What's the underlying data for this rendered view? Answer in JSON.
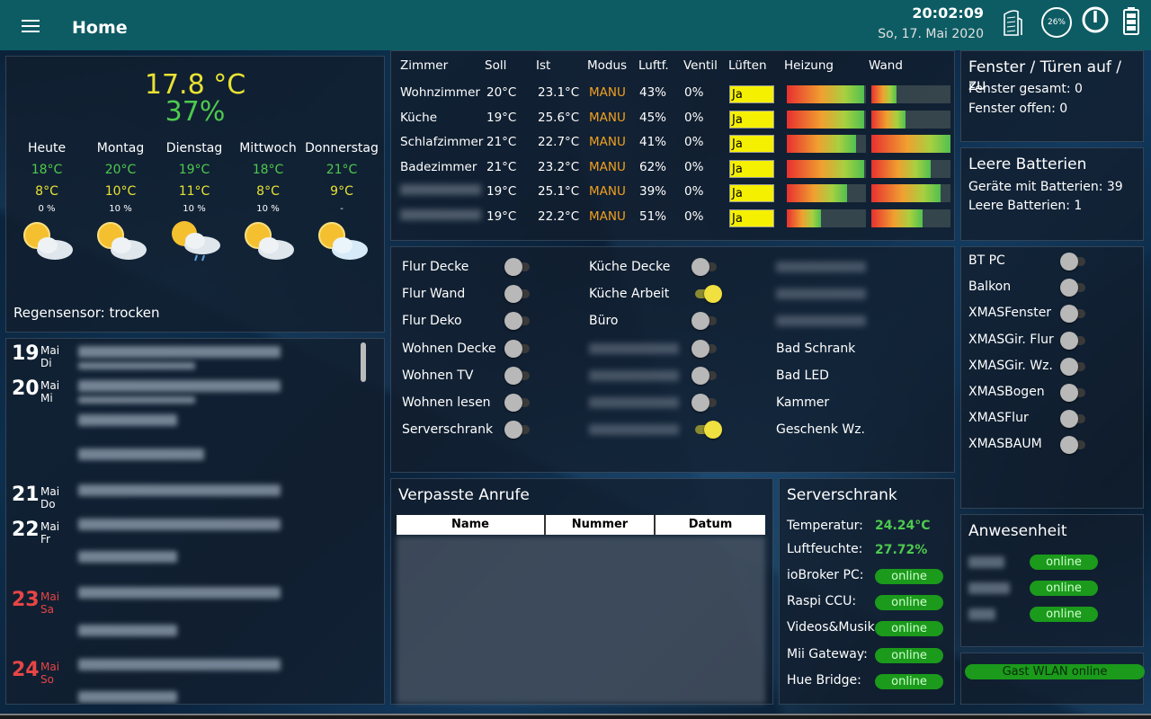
{
  "header": {
    "title": "Home",
    "time": "20:02:09",
    "date": "So, 17. Mai 2020",
    "battery_percent": "26%"
  },
  "weather": {
    "temperature": "17.8 °C",
    "humidity": "37%",
    "forecast": [
      {
        "day": "Heute",
        "high": "18°C",
        "low": "8°C",
        "rain": "0 %",
        "icon": "partly-cloudy-sun-icon"
      },
      {
        "day": "Montag",
        "high": "20°C",
        "low": "10°C",
        "rain": "10 %",
        "icon": "partly-cloudy-sun-icon"
      },
      {
        "day": "Dienstag",
        "high": "19°C",
        "low": "11°C",
        "rain": "10 %",
        "icon": "sun-rain-icon"
      },
      {
        "day": "Mittwoch",
        "high": "18°C",
        "low": "8°C",
        "rain": "10 %",
        "icon": "partly-cloudy-sun-icon"
      },
      {
        "day": "Donnerstag",
        "high": "21°C",
        "low": "9°C",
        "rain": "-",
        "icon": "partly-cloudy-sun-icon"
      }
    ],
    "rain_sensor": "Regensensor: trocken"
  },
  "calendar": {
    "days": [
      {
        "num": "19",
        "month": "Mai",
        "weekday": "Di"
      },
      {
        "num": "20",
        "month": "Mai",
        "weekday": "Mi"
      },
      {
        "num": "21",
        "month": "Mai",
        "weekday": "Do"
      },
      {
        "num": "22",
        "month": "Mai",
        "weekday": "Fr"
      },
      {
        "num": "23",
        "month": "Mai",
        "weekday": "Sa"
      },
      {
        "num": "24",
        "month": "Mai",
        "weekday": "So"
      }
    ]
  },
  "heating": {
    "headers": [
      "Zimmer",
      "Soll",
      "Ist",
      "Modus",
      "Luftf.",
      "Ventil",
      "Lüften",
      "Heizung",
      "Wand"
    ],
    "rows": [
      {
        "room": "Wohnzimmer",
        "soll": "20°C",
        "ist": "23.1°C",
        "mode": "MANU",
        "humidity": "43%",
        "valve": "0%",
        "vent": "Ja",
        "heat_level": 0.98,
        "wall_level": 0.32
      },
      {
        "room": "Küche",
        "soll": "19°C",
        "ist": "25.6°C",
        "mode": "MANU",
        "humidity": "45%",
        "valve": "0%",
        "vent": "Ja",
        "heat_level": 0.98,
        "wall_level": 0.43
      },
      {
        "room": "Schlafzimmer",
        "soll": "21°C",
        "ist": "22.7°C",
        "mode": "MANU",
        "humidity": "41%",
        "valve": "0%",
        "vent": "Ja",
        "heat_level": 0.88,
        "wall_level": 1.0
      },
      {
        "room": "Badezimmer",
        "soll": "21°C",
        "ist": "23.2°C",
        "mode": "MANU",
        "humidity": "62%",
        "valve": "0%",
        "vent": "Ja",
        "heat_level": 0.98,
        "wall_level": 0.75
      },
      {
        "room": "",
        "soll": "19°C",
        "ist": "25.1°C",
        "mode": "MANU",
        "humidity": "39%",
        "valve": "0%",
        "vent": "Ja",
        "heat_level": 0.76,
        "wall_level": 0.87
      },
      {
        "room": "",
        "soll": "19°C",
        "ist": "22.2°C",
        "mode": "MANU",
        "humidity": "51%",
        "valve": "0%",
        "vent": "Ja",
        "heat_level": 0.43,
        "wall_level": 0.65
      }
    ]
  },
  "switches": {
    "col1": [
      {
        "label": "Flur Decke",
        "on": false
      },
      {
        "label": "Flur Wand",
        "on": false
      },
      {
        "label": "Flur Deko",
        "on": false
      },
      {
        "label": "Wohnen Decke",
        "on": false
      },
      {
        "label": "Wohnen TV",
        "on": false
      },
      {
        "label": "Wohnen lesen",
        "on": false
      },
      {
        "label": "Serverschrank",
        "on": false
      }
    ],
    "col2": [
      {
        "label": "Küche Decke",
        "on": false
      },
      {
        "label": "Küche Arbeit",
        "on": true
      },
      {
        "label": "Büro",
        "on": false
      },
      {
        "label": "",
        "on": false
      },
      {
        "label": "",
        "on": false
      },
      {
        "label": "",
        "on": false
      },
      {
        "label": "",
        "on": true
      }
    ],
    "col3": [
      {
        "label": ""
      },
      {
        "label": ""
      },
      {
        "label": ""
      },
      {
        "label": "Bad Schrank"
      },
      {
        "label": "Bad LED"
      },
      {
        "label": "Kammer"
      },
      {
        "label": "Geschenk Wz."
      }
    ]
  },
  "windows": {
    "title": "Fenster / Türen auf / zu",
    "total": "Fenster gesamt: 0",
    "open": "Fenster offen: 0"
  },
  "batteries": {
    "title": "Leere Batterien",
    "devices": "Geräte mit Batterien: 39",
    "empty": "Leere Batterien: 1"
  },
  "sockets": [
    {
      "label": "BT PC",
      "on": false
    },
    {
      "label": "Balkon",
      "on": false
    },
    {
      "label": "XMASFenster",
      "on": false
    },
    {
      "label": "XMASGir. Flur",
      "on": false
    },
    {
      "label": "XMASGir. Wz.",
      "on": false
    },
    {
      "label": "XMASBogen",
      "on": false
    },
    {
      "label": "XMASFlur",
      "on": false
    },
    {
      "label": "XMASBAUM",
      "on": false
    }
  ],
  "calls": {
    "title": "Verpasste Anrufe",
    "columns": [
      "Name",
      "Nummer",
      "Datum"
    ]
  },
  "server": {
    "title": "Serverschrank",
    "temp_label": "Temperatur:",
    "temp_value": "24.24°C",
    "hum_label": "Luftfeuchte:",
    "hum_value": "27.72%",
    "devices": [
      {
        "label": "ioBroker PC:",
        "status": "online"
      },
      {
        "label": "Raspi CCU:",
        "status": "online"
      },
      {
        "label": "Videos&Musik:",
        "status": "online"
      },
      {
        "label": "Mii Gateway:",
        "status": "online"
      },
      {
        "label": "Hue Bridge:",
        "status": "online"
      }
    ]
  },
  "presence": {
    "title": "Anwesenheit",
    "entries": [
      {
        "status": "online"
      },
      {
        "status": "online"
      },
      {
        "status": "online"
      }
    ]
  },
  "guest_wlan": "Gast WLAN online",
  "colors": {
    "topbar": "#0d5c63",
    "yellow": "#e8e234",
    "green": "#4ec94e",
    "orange": "#f0a020",
    "online": "#1b9a1b"
  }
}
